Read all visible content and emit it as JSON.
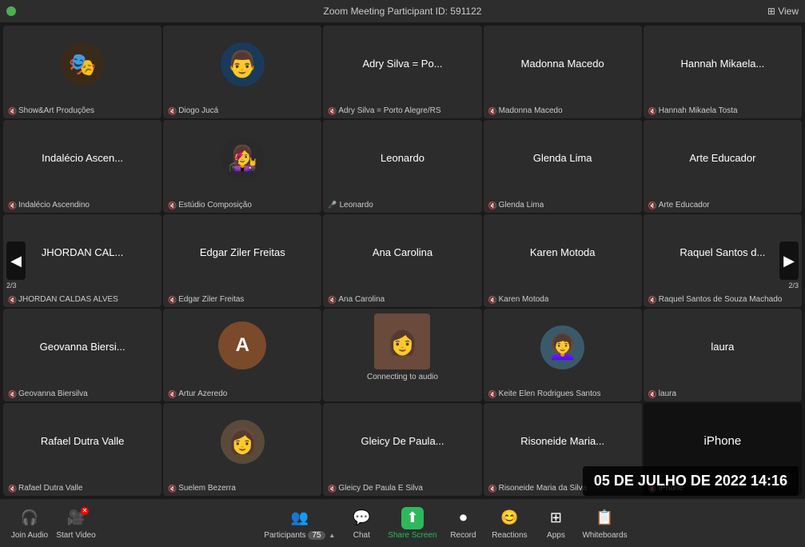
{
  "titlebar": {
    "title": "Zoom Meeting  Participant ID: 591122",
    "view_label": "⊞ View"
  },
  "participants": [
    {
      "id": "show-art",
      "name_large": "Show&Art Produções",
      "name_small": "Show&Art Produções",
      "has_photo": true,
      "photo_emoji": "🎭",
      "photo_bg": "#3a2a1a",
      "muted": true
    },
    {
      "id": "diogo",
      "name_large": "Diogo Jucá",
      "name_small": "Diogo Jucá",
      "has_photo": true,
      "photo_emoji": "👨",
      "photo_bg": "#1a3a5a",
      "muted": true
    },
    {
      "id": "adry",
      "name_large": "Adry Silva = Po...",
      "name_small": "Adry Silva = Porto Alegre/RS",
      "has_photo": false,
      "avatar_letter": "",
      "avatar_color": "#555",
      "muted": true
    },
    {
      "id": "madonna",
      "name_large": "Madonna Macedo",
      "name_small": "Madonna Macedo",
      "has_photo": false,
      "avatar_letter": "",
      "avatar_color": "#555",
      "muted": true
    },
    {
      "id": "hannah",
      "name_large": "Hannah  Mikaela...",
      "name_small": "Hannah Mikaela Tosta",
      "has_photo": false,
      "avatar_letter": "",
      "avatar_color": "#555",
      "muted": true
    },
    {
      "id": "indalecio",
      "name_large": "Indalécio  Ascen...",
      "name_small": "Indalécio Ascendino",
      "has_photo": false,
      "avatar_letter": "",
      "avatar_color": "#555",
      "muted": true
    },
    {
      "id": "estudio",
      "name_large": "Estúdio Composição",
      "name_small": "Estúdio Composição",
      "has_photo": true,
      "photo_emoji": "👩‍🎤",
      "photo_bg": "#2a2a2a",
      "muted": true
    },
    {
      "id": "leonardo",
      "name_large": "Leonardo",
      "name_small": "Leonardo",
      "has_photo": false,
      "avatar_letter": "",
      "avatar_color": "#555",
      "muted": false
    },
    {
      "id": "glenda",
      "name_large": "Glenda Lima",
      "name_small": "Glenda Lima",
      "has_photo": false,
      "avatar_letter": "",
      "avatar_color": "#555",
      "muted": true
    },
    {
      "id": "arte",
      "name_large": "Arte Educador",
      "name_small": "Arte Educador",
      "has_photo": false,
      "avatar_letter": "",
      "avatar_color": "#555",
      "muted": true
    },
    {
      "id": "jhordan",
      "name_large": "JHORDAN  CAL...",
      "name_small": "JHORDAN CALDAS ALVES",
      "has_photo": false,
      "avatar_letter": "",
      "avatar_color": "#555",
      "muted": true
    },
    {
      "id": "edgar",
      "name_large": "Edgar Ziler Freitas",
      "name_small": "Edgar Ziler Freitas",
      "has_photo": false,
      "avatar_letter": "",
      "avatar_color": "#555",
      "muted": true
    },
    {
      "id": "ana",
      "name_large": "Ana Carolina",
      "name_small": "Ana Carolina",
      "has_photo": false,
      "avatar_letter": "",
      "avatar_color": "#555",
      "muted": true
    },
    {
      "id": "karen",
      "name_large": "Karen Motoda",
      "name_small": "Karen Motoda",
      "has_photo": false,
      "avatar_letter": "",
      "avatar_color": "#555",
      "muted": true
    },
    {
      "id": "raquel",
      "name_large": "Raquel Santos d...",
      "name_small": "Raquel Santos de Souza Machado",
      "has_photo": false,
      "avatar_letter": "",
      "avatar_color": "#555",
      "muted": true
    },
    {
      "id": "geovanna",
      "name_large": "Geovanna  Biersi...",
      "name_small": "Geovanna Biersilva",
      "has_photo": false,
      "avatar_letter": "",
      "avatar_color": "#555",
      "muted": true
    },
    {
      "id": "artur",
      "name_large": "Artur Azeredo",
      "name_small": "Artur Azeredo",
      "has_photo": false,
      "avatar_letter": "A",
      "avatar_color": "#7a4a2a",
      "muted": true
    },
    {
      "id": "connecting",
      "name_large": "",
      "name_small": "",
      "has_photo": true,
      "photo_emoji": "👩",
      "photo_bg": "#4a3a2a",
      "connecting": true,
      "connecting_text": "Connecting to audio "
    },
    {
      "id": "keite",
      "name_large": "Keite Elen Rodrigues Santos",
      "name_small": "Keite Elen Rodrigues Santos",
      "has_photo": true,
      "photo_emoji": "👩‍🦱",
      "photo_bg": "#3a5a6a",
      "muted": true
    },
    {
      "id": "laura",
      "name_large": "laura",
      "name_small": "laura",
      "has_photo": false,
      "avatar_letter": "",
      "avatar_color": "#555",
      "muted": true
    },
    {
      "id": "rafael",
      "name_large": "Rafael Dutra Valle",
      "name_small": "Rafael Dutra Valle",
      "has_photo": false,
      "avatar_letter": "",
      "avatar_color": "#555",
      "muted": true
    },
    {
      "id": "suelem",
      "name_large": "Suelem Bezerra",
      "name_small": "Suelem Bezerra",
      "has_photo": true,
      "photo_emoji": "👩",
      "photo_bg": "#5a4a3a",
      "muted": true
    },
    {
      "id": "gleicy",
      "name_large": "Gleicy De Paula...",
      "name_small": "Gleicy De Paula E Silva",
      "has_photo": false,
      "avatar_letter": "",
      "avatar_color": "#555",
      "muted": true
    },
    {
      "id": "risoneide",
      "name_large": "Risoneide  Maria...",
      "name_small": "Risoneide Maria da Silva",
      "has_photo": false,
      "avatar_letter": "",
      "avatar_color": "#555",
      "muted": true
    },
    {
      "id": "iphone",
      "name_large": "iPhone",
      "name_small": "iPhone",
      "has_photo": false,
      "avatar_letter": "",
      "avatar_color": "#1a1a1a",
      "muted": true,
      "is_iphone": true
    }
  ],
  "nav": {
    "left_arrow": "◀",
    "right_arrow": "▶",
    "page_left": "2/3",
    "page_right": "2/3"
  },
  "toolbar": {
    "join_audio_label": "Join Audio",
    "start_video_label": "Start Video",
    "participants_label": "Participants",
    "participants_count": "75",
    "chat_label": "Chat",
    "share_screen_label": "Share Screen",
    "record_label": "Record",
    "reactions_label": "Reactions",
    "apps_label": "Apps",
    "whiteboards_label": "Whiteboards"
  },
  "timestamp": "05 DE JULHO DE 2022 14:16"
}
